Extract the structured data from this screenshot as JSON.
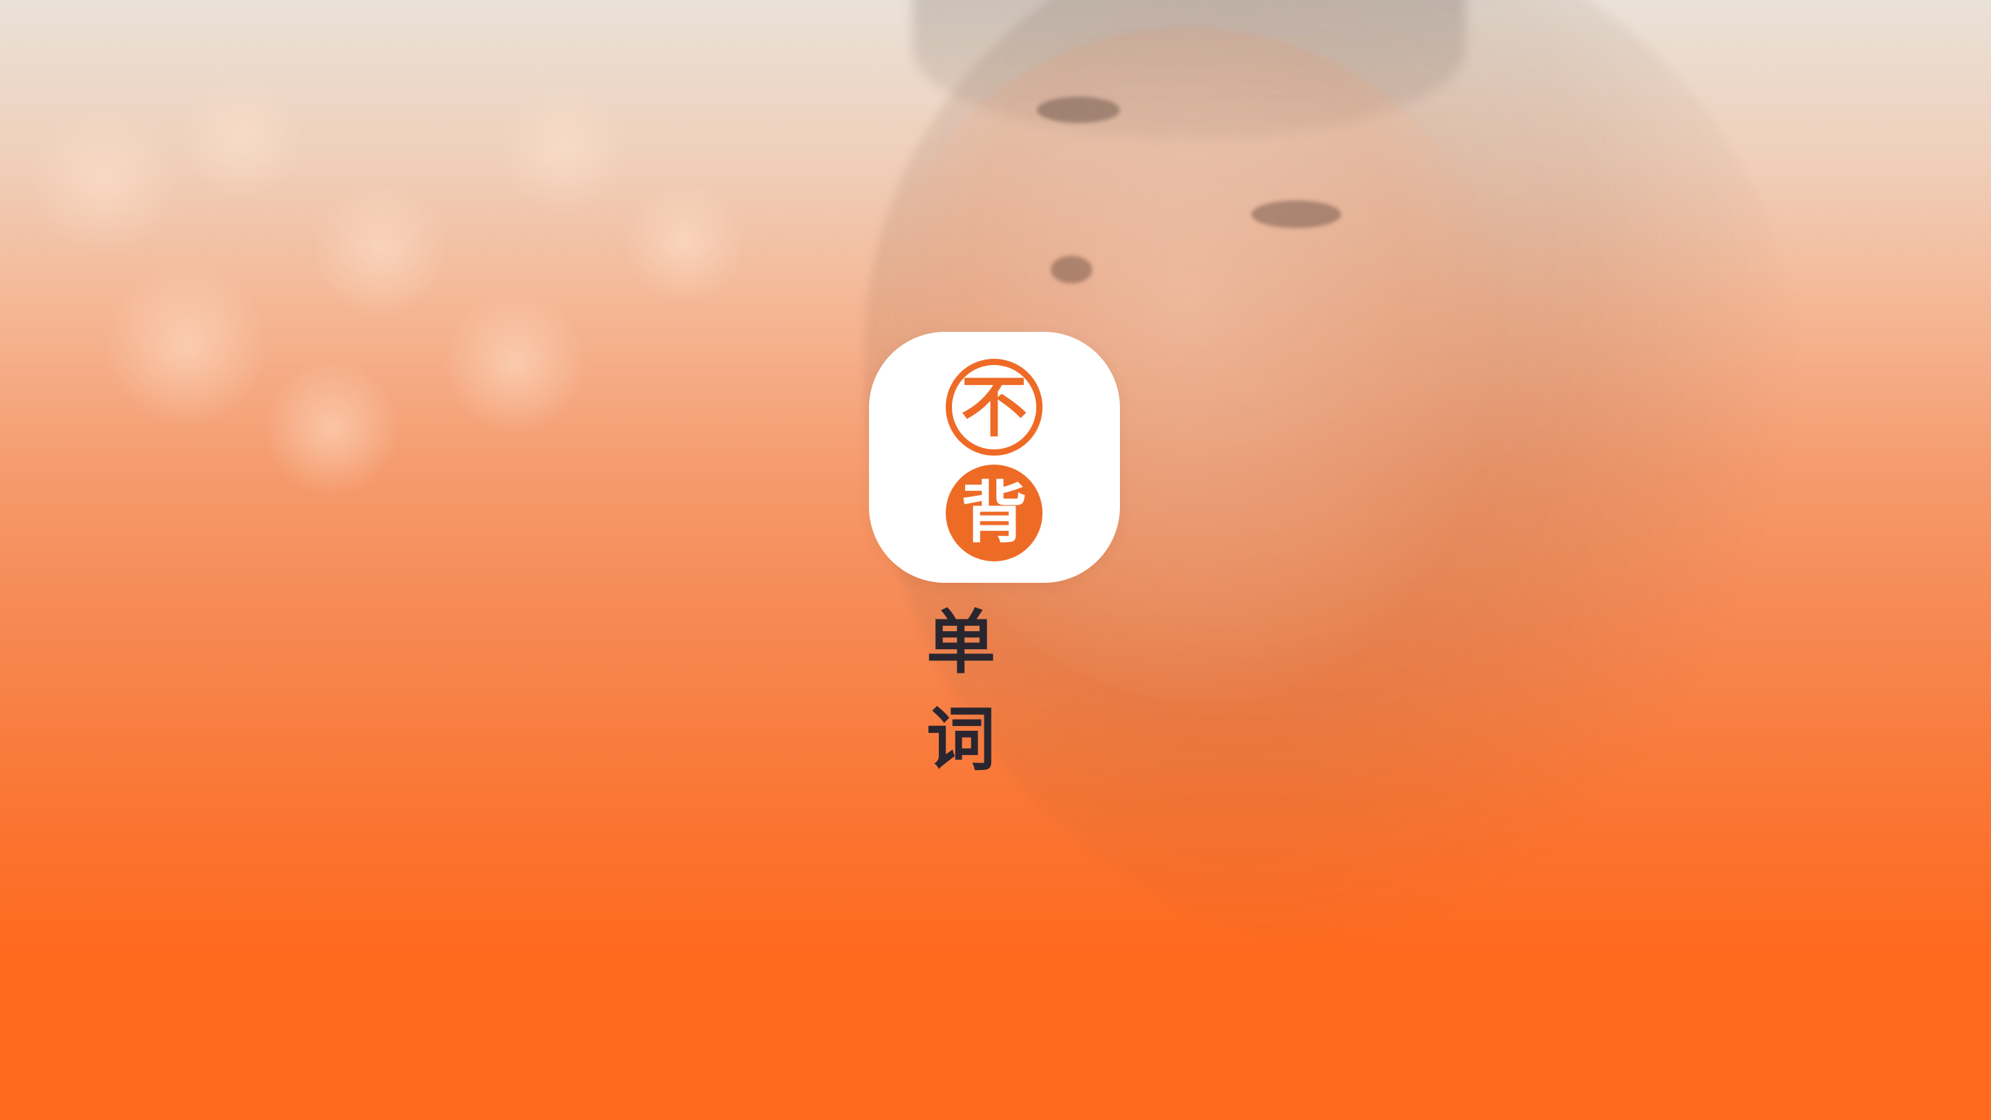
{
  "app": {
    "name": "不背单词",
    "icon": {
      "top_char": "不",
      "bottom_char": "背",
      "accent_color": "#EE6B26",
      "background_color": "#FFFFFF"
    },
    "title_chars": [
      "单",
      "词"
    ]
  },
  "splash": {
    "background_color": "#FF6A1F",
    "image": "blurred-portrait-photo"
  }
}
